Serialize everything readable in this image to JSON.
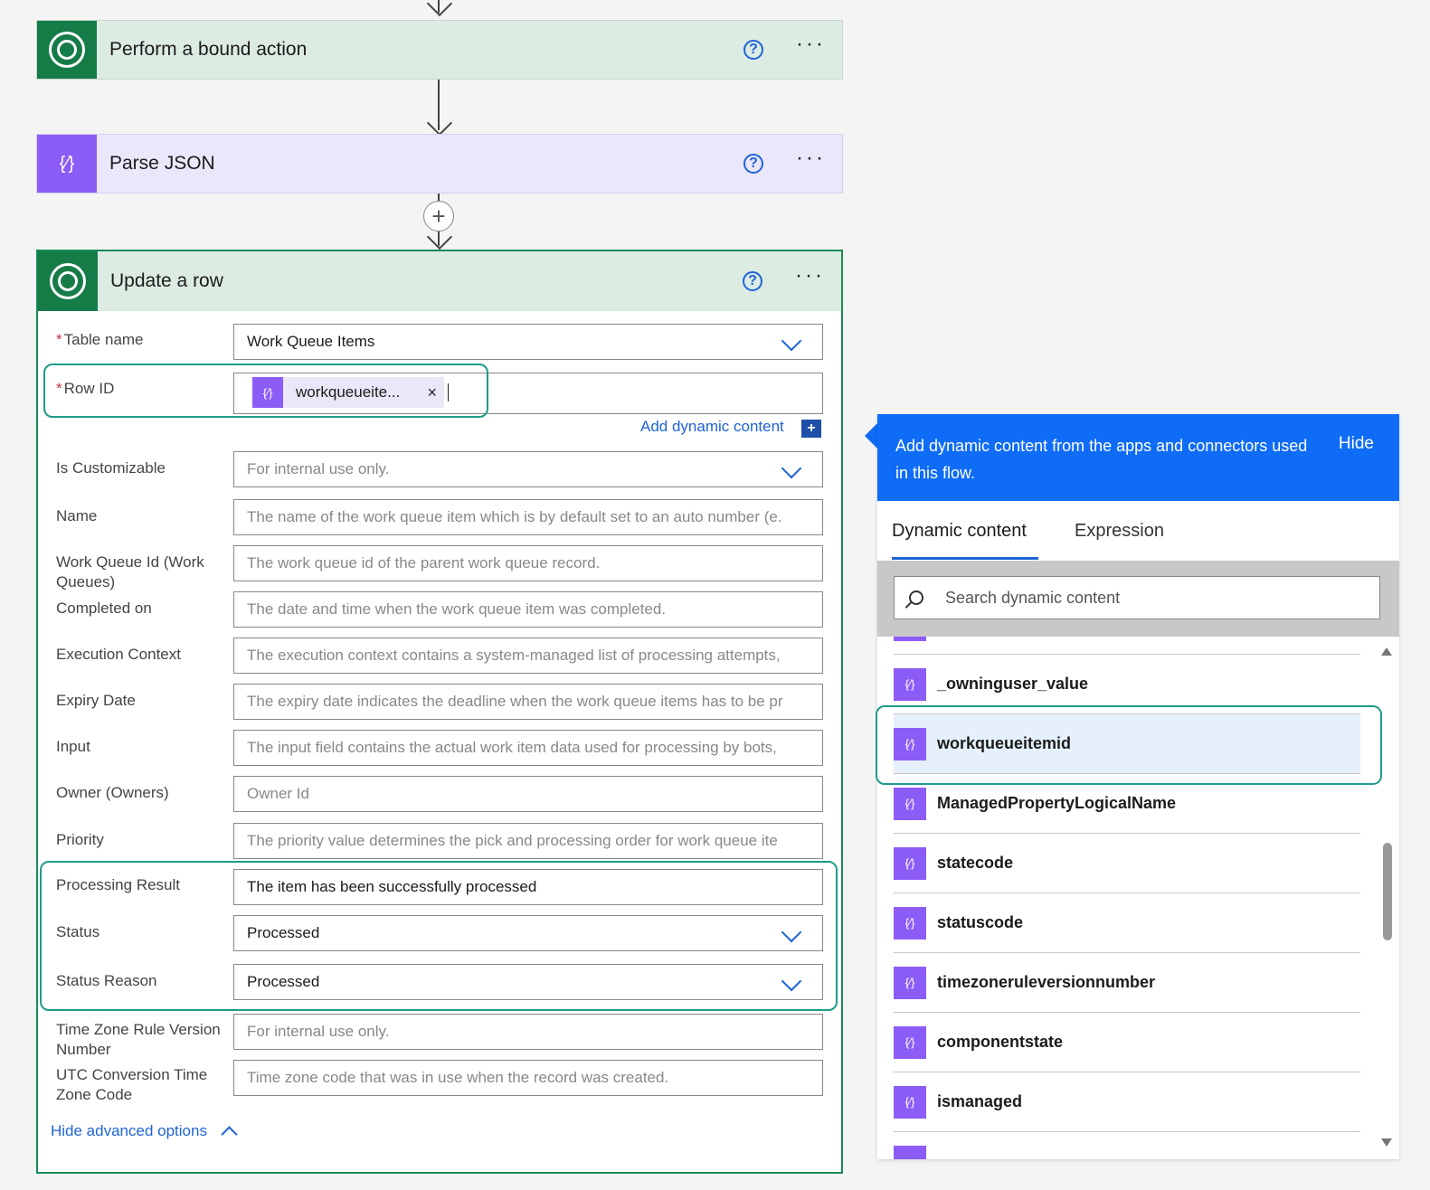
{
  "flow": {
    "step1": {
      "title": "Perform a bound action",
      "help": "?",
      "more": "···"
    },
    "step2": {
      "title": "Parse JSON",
      "help": "?",
      "more": "···"
    },
    "add_step": "+"
  },
  "update_row": {
    "title": "Update a row",
    "help": "?",
    "more": "···",
    "fields": {
      "table_name": {
        "label": "Table name",
        "required": "*",
        "value": "Work Queue Items"
      },
      "row_id": {
        "label": "Row ID",
        "required": "*",
        "token": "workqueueite...",
        "token_icon": "{⁄}",
        "token_remove": "×"
      },
      "add_dynamic": "Add dynamic content",
      "add_dynamic_icon": "+",
      "is_customizable": {
        "label": "Is Customizable",
        "placeholder": "For internal use only."
      },
      "name": {
        "label": "Name",
        "placeholder": "The name of the work queue item which is by default set to an auto number (e."
      },
      "work_queue_id": {
        "label": "Work Queue Id (Work Queues)",
        "placeholder": "The work queue id of the parent work queue record."
      },
      "completed_on": {
        "label": "Completed on",
        "placeholder": "The date and time when the work queue item was completed."
      },
      "execution_context": {
        "label": "Execution Context",
        "placeholder": "The execution context contains a system-managed list of processing attempts,"
      },
      "expiry_date": {
        "label": "Expiry Date",
        "placeholder": "The expiry date indicates the deadline when the work queue items has to be pr"
      },
      "input": {
        "label": "Input",
        "placeholder": "The input field contains the actual work item data used for processing by bots,"
      },
      "owner": {
        "label": "Owner (Owners)",
        "placeholder": "Owner Id"
      },
      "priority": {
        "label": "Priority",
        "placeholder": "The priority value determines the pick and processing order for work queue ite"
      },
      "processing_result": {
        "label": "Processing Result",
        "value": "The item has been successfully processed"
      },
      "status": {
        "label": "Status",
        "value": "Processed"
      },
      "status_reason": {
        "label": "Status Reason",
        "value": "Processed"
      },
      "tz_rule": {
        "label": "Time Zone Rule Version Number",
        "placeholder": "For internal use only."
      },
      "utc_code": {
        "label": "UTC Conversion Time Zone Code",
        "placeholder": "Time zone code that was in use when the record was created."
      }
    },
    "hide_advanced": "Hide advanced options"
  },
  "dynamic_panel": {
    "description": "Add dynamic content from the apps and connectors used in this flow.",
    "hide": "Hide",
    "tabs": [
      "Dynamic content",
      "Expression"
    ],
    "search_placeholder": "Search dynamic content",
    "item_icon": "{⁄}",
    "items": [
      "_owninguser_value",
      "workqueueitemid",
      "ManagedPropertyLogicalName",
      "statecode",
      "statuscode",
      "timezoneruleversionnumber",
      "componentstate",
      "ismanaged"
    ],
    "selected_item": "workqueueitemid"
  },
  "colors": {
    "dataverse_green": "#157c47",
    "parse_json_purple": "#8b5cf6",
    "accent_blue": "#0f6cf6",
    "highlight_teal": "#1f9b8a"
  }
}
